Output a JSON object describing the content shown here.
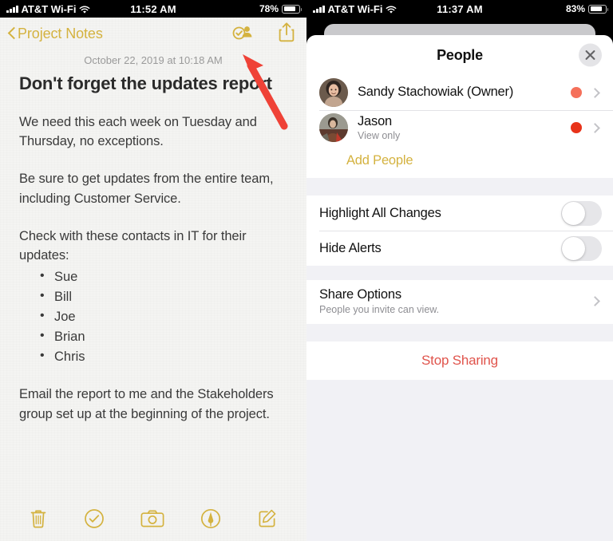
{
  "left": {
    "status_bar": {
      "signal_icon": "signal-bars-icon",
      "carrier": "AT&T Wi-Fi",
      "wifi_icon": "wifi-icon",
      "time": "11:52 AM",
      "battery_percent": "78%",
      "battery_icon": "battery-icon",
      "battery_level": 78
    },
    "nav": {
      "back_icon": "chevron-left-icon",
      "back_label": "Project Notes",
      "collaborate_icon": "people-collaborate-icon",
      "share_icon": "share-upload-icon"
    },
    "note": {
      "date": "October 22, 2019 at 10:18 AM",
      "title": "Don't forget the updates report",
      "paragraphs": [
        "We need this each week on Tuesday and Thursday, no exceptions.",
        "Be sure to get updates from the entire team, including Customer Service.",
        "Check with these contacts in IT for their updates:"
      ],
      "bullets": [
        "Sue",
        "Bill",
        "Joe",
        "Brian",
        "Chris"
      ],
      "closing": "Email the report to me and the Stakeholders group set up at the beginning of the project."
    },
    "toolbar": [
      {
        "name": "delete-icon",
        "label": "Delete"
      },
      {
        "name": "checklist-icon",
        "label": "Checklist"
      },
      {
        "name": "camera-icon",
        "label": "Camera"
      },
      {
        "name": "markup-icon",
        "label": "Markup"
      },
      {
        "name": "compose-icon",
        "label": "Compose"
      }
    ],
    "annotation": {
      "arrow_icon": "red-arrow-annotation",
      "color": "#ef4237"
    }
  },
  "right": {
    "status_bar": {
      "signal_icon": "signal-bars-icon",
      "carrier": "AT&T Wi-Fi",
      "wifi_icon": "wifi-icon",
      "time": "11:37 AM",
      "battery_percent": "83%",
      "battery_icon": "battery-icon",
      "battery_level": 83
    },
    "sheet": {
      "title": "People",
      "close_icon": "close-x-icon",
      "people": [
        {
          "name": "Sandy Stachowiak (Owner)",
          "subtitle": "",
          "dot_color": "#f5705a",
          "avatar": "avatar-sandy",
          "chevron_icon": "chevron-right-icon"
        },
        {
          "name": "Jason",
          "subtitle": "View only",
          "dot_color": "#e8331a",
          "avatar": "avatar-jason",
          "chevron_icon": "chevron-right-icon"
        }
      ],
      "add_people_label": "Add People",
      "settings": [
        {
          "label": "Highlight All Changes",
          "toggle_on": false
        },
        {
          "label": "Hide Alerts",
          "toggle_on": false
        }
      ],
      "share_options": {
        "title": "Share Options",
        "subtitle": "People you invite can view.",
        "chevron_icon": "chevron-right-icon"
      },
      "stop_sharing_label": "Stop Sharing",
      "accent_color": "#d4b23f",
      "destructive_color": "#e0544c"
    }
  }
}
